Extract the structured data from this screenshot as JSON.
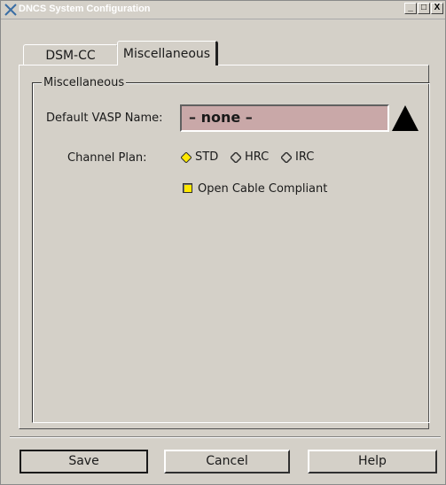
{
  "window": {
    "title": "DNCS System Configuration",
    "controls": [
      "_",
      "□",
      "X"
    ]
  },
  "tabs": [
    {
      "label": "DSM-CC",
      "selected": false
    },
    {
      "label": "Miscellaneous",
      "selected": true
    }
  ],
  "group": {
    "legend": "Miscellaneous"
  },
  "vasp": {
    "label": "Default VASP Name:",
    "value": "– none –"
  },
  "channel_plan": {
    "label": "Channel Plan:",
    "options": [
      {
        "label": "STD",
        "selected": true
      },
      {
        "label": "HRC",
        "selected": false
      },
      {
        "label": "IRC",
        "selected": false
      }
    ]
  },
  "open_cable": {
    "label": "Open Cable Compliant",
    "checked": true
  },
  "buttons": {
    "save": "Save",
    "cancel": "Cancel",
    "help": "Help"
  },
  "colors": {
    "field_bg": "#c9a8a8",
    "checkbox_fill": "#ffe800",
    "radio_selected": "#ffe800",
    "window_bg": "#d4d0c8"
  }
}
